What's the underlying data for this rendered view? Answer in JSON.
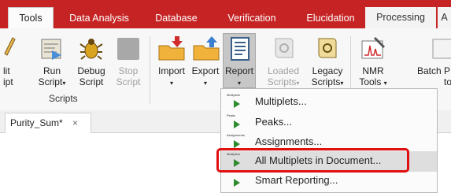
{
  "tabs": [
    {
      "label": "Tools",
      "active": true
    },
    {
      "label": "Data Analysis"
    },
    {
      "label": "Database"
    },
    {
      "label": "Verification"
    },
    {
      "label": "Elucidation"
    },
    {
      "label": "Processing"
    },
    {
      "label": "A"
    }
  ],
  "ribbon": {
    "split_script": {
      "line1": "lit",
      "line2": "ipt"
    },
    "run_script": {
      "line1": "Run",
      "line2": "Script"
    },
    "debug_script": {
      "line1": "Debug",
      "line2": "Script"
    },
    "stop_script": {
      "line1": "Stop",
      "line2": "Script"
    },
    "import": {
      "line1": "Import"
    },
    "export": {
      "line1": "Export"
    },
    "report": {
      "line1": "Report"
    },
    "loaded_scripts": {
      "line1": "Loaded",
      "line2": "Scripts"
    },
    "legacy_scripts": {
      "line1": "Legacy",
      "line2": "Scripts"
    },
    "nmr_tools": {
      "line1": "NMR",
      "line2": "Tools"
    },
    "batch": {
      "line1": "Batch P",
      "line2": "to"
    },
    "group_scripts": "Scripts",
    "dropdown_caret": "▾"
  },
  "document_tab": {
    "label": "Purity_Sum*",
    "close": "×"
  },
  "menu": {
    "items": [
      {
        "label": "Multiplets...",
        "icon_text": "Multiplets"
      },
      {
        "label": "Peaks...",
        "icon_text": "Peaks"
      },
      {
        "label": "Assignments...",
        "icon_text": "Assignments"
      },
      {
        "label": "All Multiplets in Document...",
        "icon_text": "Multiplets",
        "highlighted": true
      },
      {
        "label": "Smart Reporting...",
        "icon_text": ""
      }
    ]
  },
  "colors": {
    "accent": "#c62424",
    "highlight_box": "#e01010",
    "play": "#2e8b2e"
  }
}
